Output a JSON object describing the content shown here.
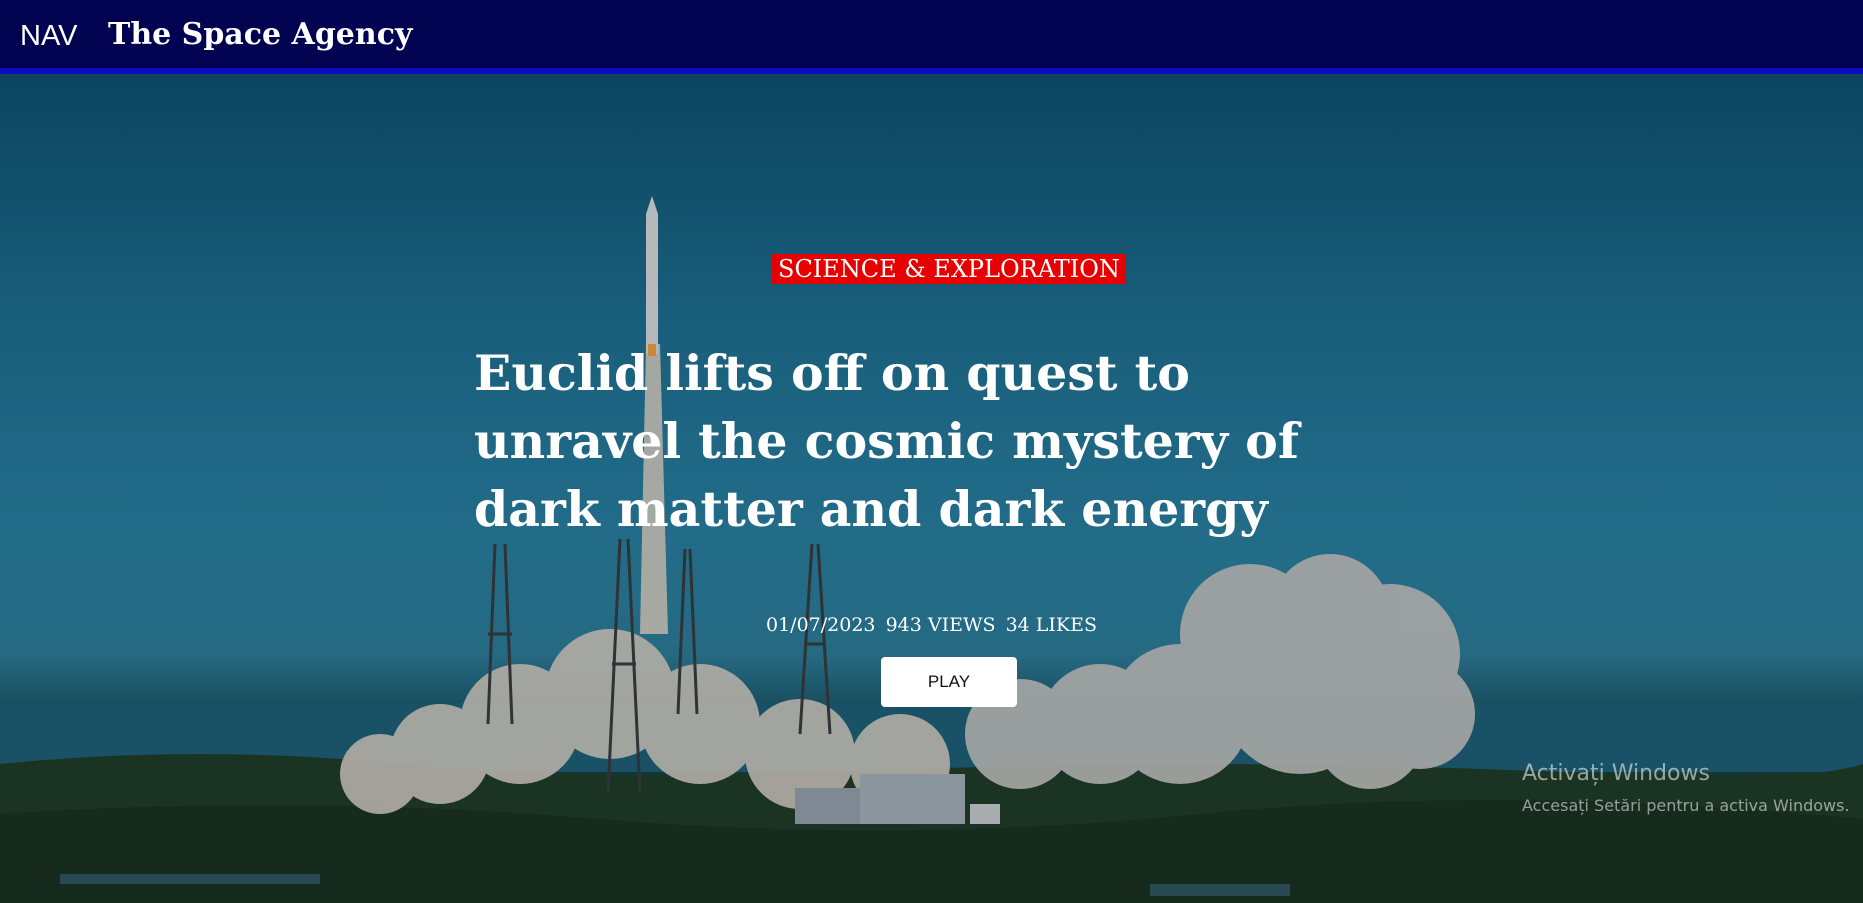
{
  "header": {
    "nav_label": "NAV",
    "site_title": "The Space Agency"
  },
  "hero": {
    "category": "SCIENCE & EXPLORATION",
    "headline": "Euclid lifts off on quest to unravel the cosmic mystery of dark matter and dark energy",
    "date": "01/07/2023",
    "views": "943 VIEWS",
    "likes": "34 LIKES",
    "play_label": "PLAY"
  },
  "os_watermark": {
    "title": "Activați Windows",
    "subtitle": "Accesați Setări pentru a activa Windows."
  },
  "colors": {
    "header_bg": "#010350",
    "header_border": "#0b0bbd",
    "category_bg": "#e60000"
  }
}
